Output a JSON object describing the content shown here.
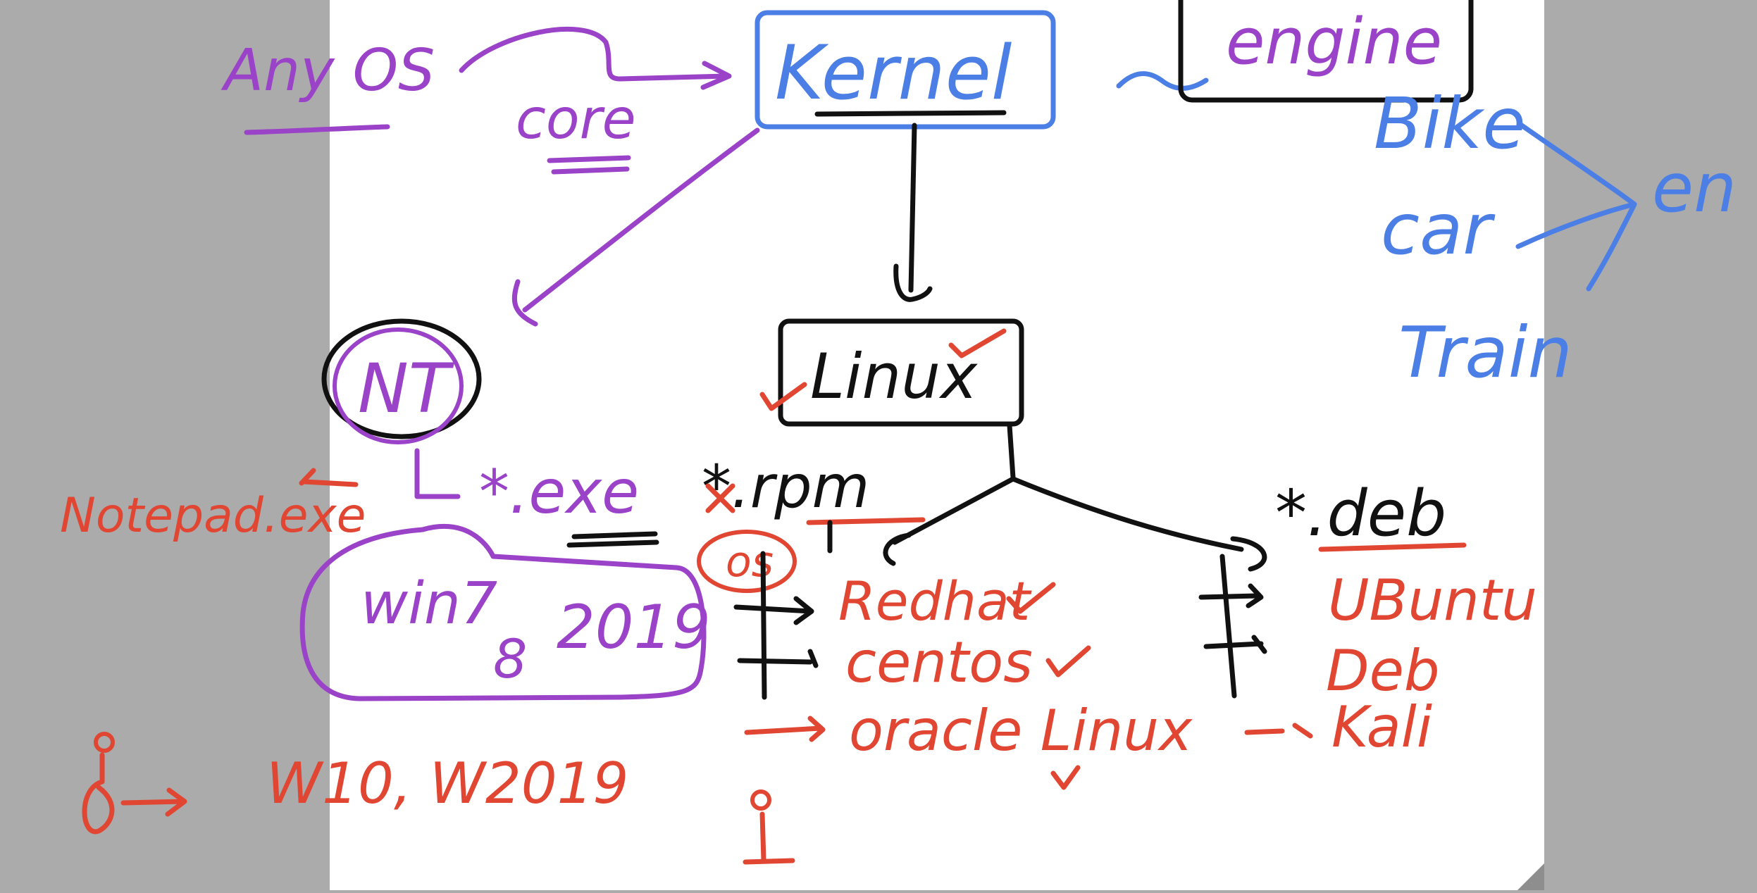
{
  "colors": {
    "purple": "#9a42c8",
    "blue": "#4c7fe6",
    "black": "#111111",
    "red": "#e04632",
    "page": "#ffffff",
    "margin": "#ababab"
  },
  "labels": {
    "any_os": "Any OS",
    "core": "core",
    "kernel": "Kernel",
    "engine": "engine",
    "bike": "Bike",
    "car": "car",
    "train": "Train",
    "en": "en",
    "nt": "NT",
    "notepad": "Notepad.exe",
    "exe": "*.exe",
    "rpm": "*.rpm",
    "linux": "Linux",
    "deb_ext": "*.deb",
    "win7": "win7",
    "win8": "8",
    "win2019": "2019",
    "os": "os",
    "redhat": "Redhat",
    "centos": "centos",
    "oracle": "oracle Linux",
    "ubuntu": "UBuntu",
    "debian": "Deb",
    "kali": "Kali",
    "w10": "W10, W2019"
  }
}
